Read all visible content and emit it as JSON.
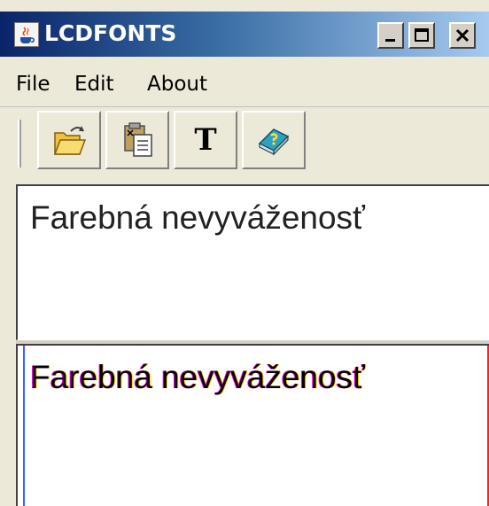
{
  "window": {
    "title": "LCDFONTS",
    "controls": [
      "minimize",
      "maximize",
      "close"
    ]
  },
  "menu": {
    "items": [
      {
        "label": "File"
      },
      {
        "label": "Edit"
      },
      {
        "label": "About"
      }
    ]
  },
  "toolbar": {
    "buttons": [
      {
        "icon": "open-folder-icon"
      },
      {
        "icon": "clipboard-icon"
      },
      {
        "icon": "text-font-icon",
        "glyph": "T"
      },
      {
        "icon": "help-book-icon"
      }
    ]
  },
  "panes": {
    "plain_text": "Farebná nevyváženosť",
    "subpixel_text": "Farebná nevyváženosť"
  },
  "colors": {
    "titlebar_start": "#0a246a",
    "titlebar_end": "#a6caf0",
    "subpixel_fringe_left": "#4060ff",
    "subpixel_fringe_right": "#ff2020"
  }
}
